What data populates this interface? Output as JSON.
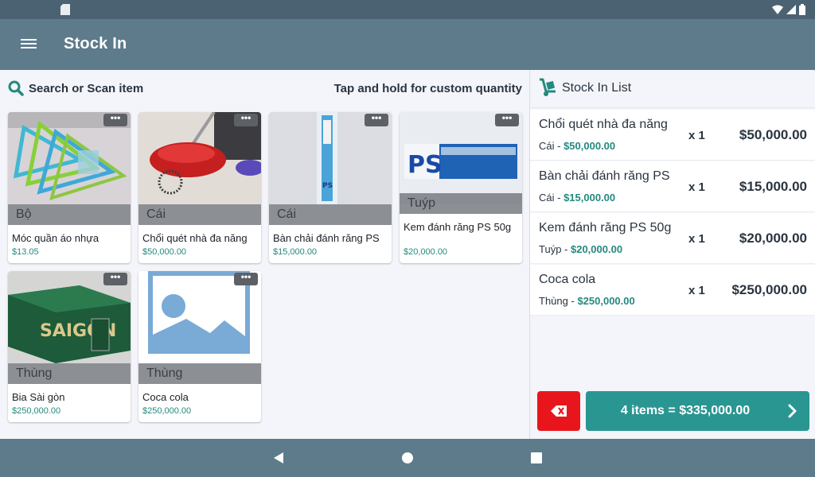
{
  "app": {
    "title": "Stock In"
  },
  "search": {
    "label": "Search or Scan item",
    "hint": "Tap and hold for custom quantity"
  },
  "products": [
    {
      "unit": "Bộ",
      "name": "Móc quần áo nhựa",
      "price": "$13.05",
      "image": "hangers-photo"
    },
    {
      "unit": "Cái",
      "name": "Chổi quét nhà đa năng",
      "price": "$50,000.00",
      "image": "broom-photo"
    },
    {
      "unit": "Cái",
      "name": "Bàn chải đánh răng PS",
      "price": "$15,000.00",
      "image": "toothbrush-photo"
    },
    {
      "unit": "Tuýp",
      "name": "Kem đánh răng PS 50g",
      "price": "$20,000.00",
      "image": "toothpaste-photo"
    },
    {
      "unit": "Thùng",
      "name": "Bia Sài gòn",
      "price": "$250,000.00",
      "image": "beer-box-photo"
    },
    {
      "unit": "Thùng",
      "name": "Coca cola",
      "price": "$250,000.00",
      "image": "placeholder-image-icon"
    }
  ],
  "more_label": "•••",
  "stock_list": {
    "title": "Stock In List",
    "rows": [
      {
        "name": "Chổi quét nhà đa năng",
        "unit": "Cái",
        "unit_price": "$50,000.00",
        "qty": "x 1",
        "total": "$50,000.00"
      },
      {
        "name": "Bàn chải đánh răng PS",
        "unit": "Cái",
        "unit_price": "$15,000.00",
        "qty": "x 1",
        "total": "$15,000.00"
      },
      {
        "name": "Kem đánh răng PS 50g",
        "unit": "Tuýp",
        "unit_price": "$20,000.00",
        "qty": "x 1",
        "total": "$20,000.00"
      },
      {
        "name": "Coca cola",
        "unit": "Thùng",
        "unit_price": "$250,000.00",
        "qty": "x 1",
        "total": "$250,000.00"
      }
    ],
    "checkout_label": "4 items = $335,000.00"
  },
  "colors": {
    "app_bar": "#5e7b8c",
    "status_bar": "#4b6272",
    "accent": "#2a9692",
    "price": "#24897f",
    "danger": "#e8161c"
  },
  "icons": {
    "menu": "hamburger-icon",
    "search": "search-icon",
    "list": "hand-truck-icon",
    "clear": "backspace-x-icon",
    "checkout": "chevron-right-icon"
  }
}
